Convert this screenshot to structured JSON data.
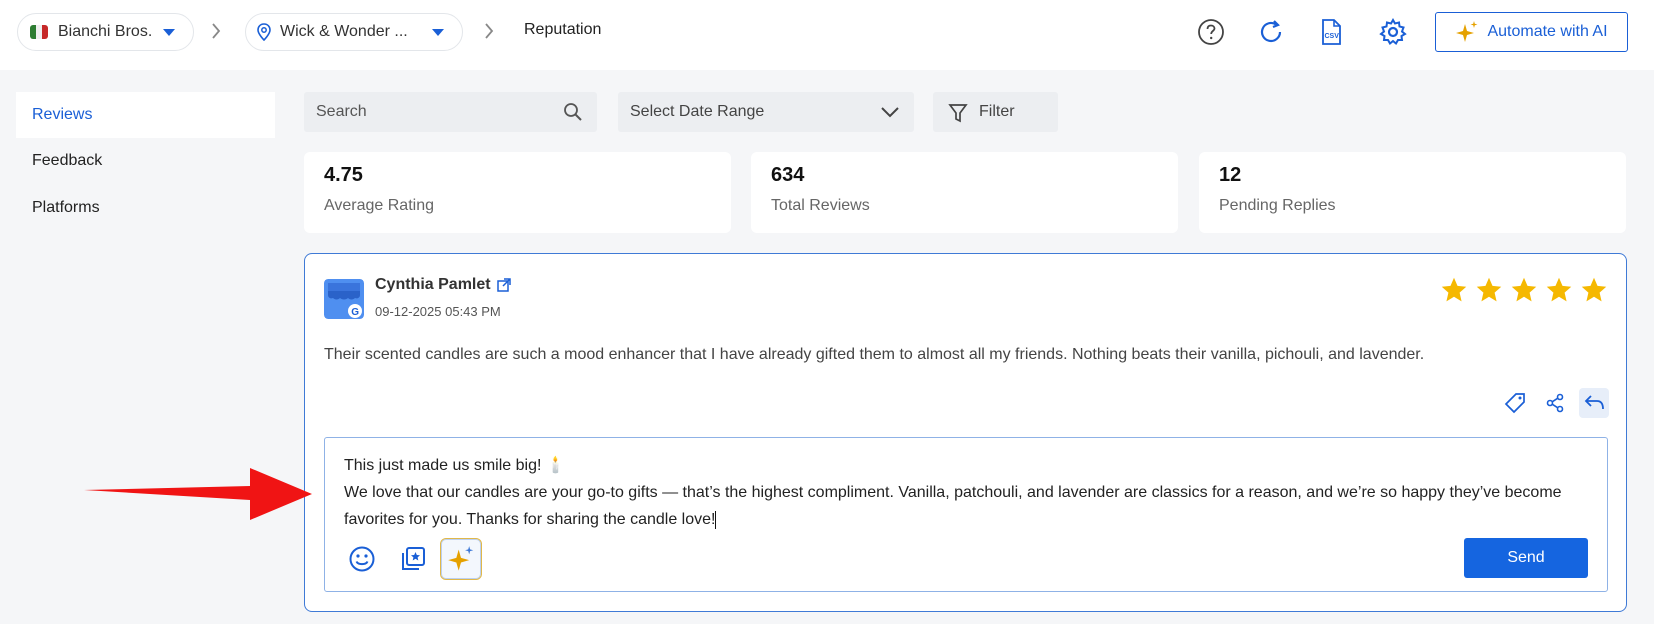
{
  "header": {
    "org_name": "Bianchi Bros.",
    "location_name": "Wick & Wonder ...",
    "current_page": "Reputation",
    "automate_label": "Automate with AI"
  },
  "sidebar": {
    "items": [
      {
        "label": "Reviews",
        "active": true
      },
      {
        "label": "Feedback",
        "active": false
      },
      {
        "label": "Platforms",
        "active": false
      }
    ]
  },
  "toolbar": {
    "search_placeholder": "Search",
    "date_range_label": "Select Date Range",
    "filter_label": "Filter"
  },
  "stats": [
    {
      "value": "4.75",
      "label": "Average Rating"
    },
    {
      "value": "634",
      "label": "Total Reviews"
    },
    {
      "value": "12",
      "label": "Pending Replies"
    }
  ],
  "review": {
    "platform_icon": "google-business-icon",
    "reviewer_name": "Cynthia Pamlet",
    "date": "09-12-2025 05:43 PM",
    "rating": 5,
    "rating_max": 5,
    "text": "Their scented candles are such a mood enhancer that I have already gifted them to almost all my friends. Nothing beats their vanilla, pichouli, and lavender."
  },
  "reply": {
    "line1": "This just made us smile big! 🕯️",
    "line2": "We love that our candles are your go-to gifts — that’s the highest compliment. Vanilla, patchouli, and lavender are classics for a reason, and we’re so happy they’ve become favorites for you. Thanks for sharing the candle love!",
    "send_label": "Send"
  },
  "colors": {
    "accent": "#1a5fd6",
    "star": "#f5b800",
    "send_button": "#1565e0",
    "arrow": "#f01414"
  }
}
